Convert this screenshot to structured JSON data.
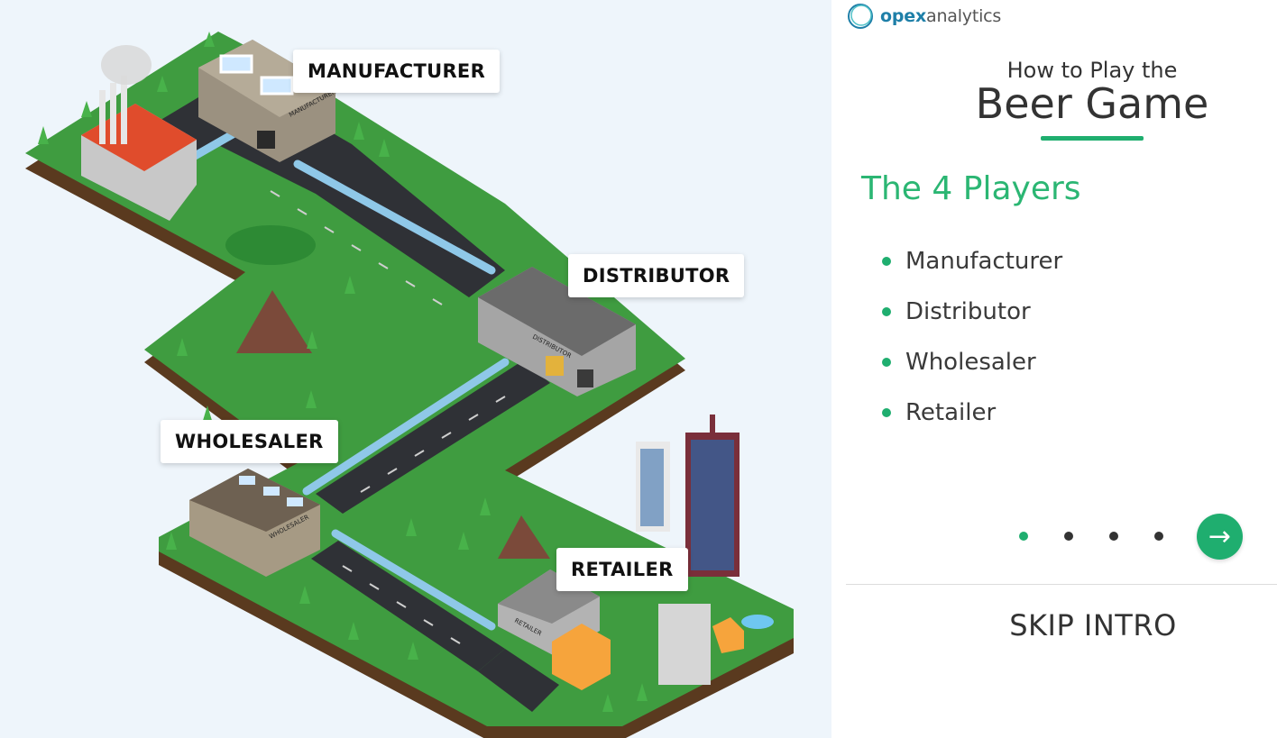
{
  "logo": {
    "brand_bold": "opex",
    "brand_rest": "analytics"
  },
  "header": {
    "subtitle": "How to Play the",
    "title": "Beer Game"
  },
  "players": {
    "heading": "The 4 Players",
    "items": [
      "Manufacturer",
      "Distributor",
      "Wholesaler",
      "Retailer"
    ]
  },
  "map_labels": {
    "manufacturer": "MANUFACTURER",
    "distributor": "DISTRIBUTOR",
    "wholesaler": "WHOLESALER",
    "retailer": "RETAILER"
  },
  "building_signs": {
    "manufacturer": "MANUFACTURER",
    "distributor": "DISTRIBUTOR",
    "wholesaler": "WHOLESALER",
    "retailer": "RETAILER"
  },
  "pager": {
    "total": 4,
    "current": 1
  },
  "navigation": {
    "next_icon": "arrow-right-icon",
    "skip_label": "SKIP INTRO"
  },
  "colors": {
    "accent": "#1fae6f",
    "grass": "#3d9b3f",
    "road": "#2f3136",
    "pipe": "#8fc8e8",
    "background": "#eef5fb"
  }
}
